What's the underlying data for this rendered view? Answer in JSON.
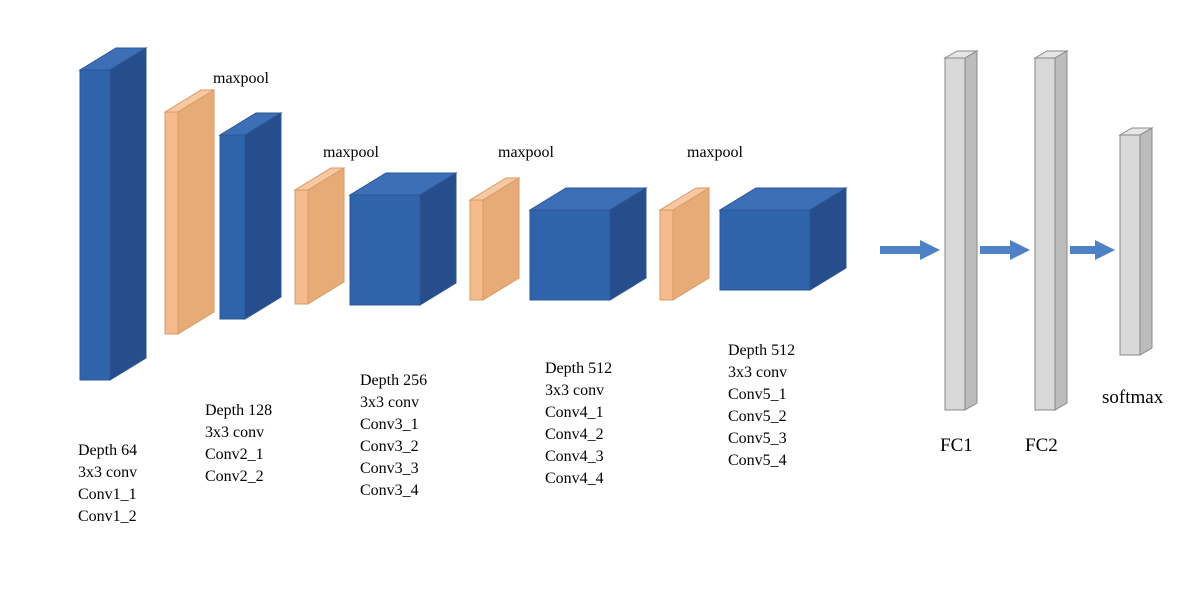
{
  "blocks": {
    "conv1": {
      "depth": "Depth 64",
      "conv": "3x3 conv",
      "l1": "Conv1_1",
      "l2": "Conv1_2"
    },
    "conv2": {
      "depth": "Depth 128",
      "conv": "3x3 conv",
      "l1": "Conv2_1",
      "l2": "Conv2_2"
    },
    "conv3": {
      "depth": "Depth 256",
      "conv": "3x3 conv",
      "l1": "Conv3_1",
      "l2": "Conv3_2",
      "l3": "Conv3_3",
      "l4": "Conv3_4"
    },
    "conv4": {
      "depth": "Depth 512",
      "conv": "3x3 conv",
      "l1": "Conv4_1",
      "l2": "Conv4_2",
      "l3": "Conv4_3",
      "l4": "Conv4_4"
    },
    "conv5": {
      "depth": "Depth 512",
      "conv": "3x3 conv",
      "l1": "Conv5_1",
      "l2": "Conv5_2",
      "l3": "Conv5_3",
      "l4": "Conv5_4"
    }
  },
  "maxpool": "maxpool",
  "fc1": "FC1",
  "fc2": "FC2",
  "softmax": "softmax",
  "chart_data": {
    "type": "diagram",
    "architecture": "VGG-like CNN",
    "layers": [
      {
        "name": "Conv1",
        "type": "conv",
        "depth": 64,
        "kernel": "3x3",
        "count": 2
      },
      {
        "name": "maxpool",
        "type": "maxpool"
      },
      {
        "name": "Conv2",
        "type": "conv",
        "depth": 128,
        "kernel": "3x3",
        "count": 2
      },
      {
        "name": "maxpool",
        "type": "maxpool"
      },
      {
        "name": "Conv3",
        "type": "conv",
        "depth": 256,
        "kernel": "3x3",
        "count": 4
      },
      {
        "name": "maxpool",
        "type": "maxpool"
      },
      {
        "name": "Conv4",
        "type": "conv",
        "depth": 512,
        "kernel": "3x3",
        "count": 4
      },
      {
        "name": "maxpool",
        "type": "maxpool"
      },
      {
        "name": "Conv5",
        "type": "conv",
        "depth": 512,
        "kernel": "3x3",
        "count": 4
      },
      {
        "name": "FC1",
        "type": "fc"
      },
      {
        "name": "FC2",
        "type": "fc"
      },
      {
        "name": "softmax",
        "type": "softmax"
      }
    ]
  }
}
